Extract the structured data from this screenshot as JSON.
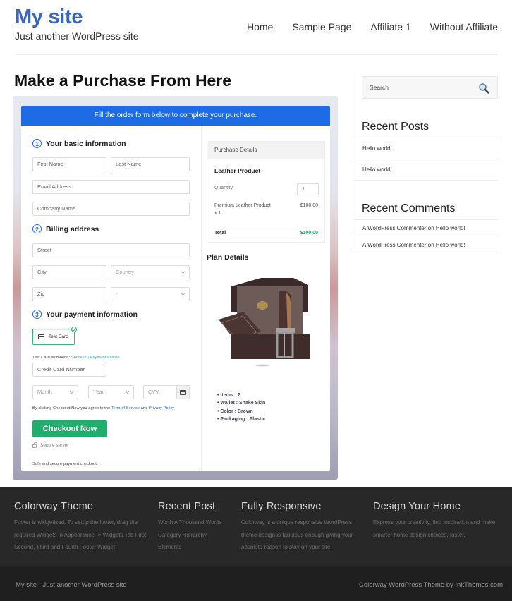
{
  "header": {
    "site_title": "My site",
    "tagline": "Just another WordPress site",
    "nav": [
      "Home",
      "Sample Page",
      "Affiliate 1",
      "Without Affiliate"
    ]
  },
  "main": {
    "page_title": "Make a Purchase From Here",
    "banner": "Fill the order form below to complete your purchase.",
    "steps": [
      "Your basic information",
      "Billing address",
      "Your payment information"
    ],
    "step_numbers": [
      "1",
      "2",
      "3"
    ],
    "fields": {
      "first_name": "First Name",
      "last_name": "Last Name",
      "email": "Email Address",
      "company": "Company Name",
      "street": "Street",
      "city": "City",
      "country": "Country",
      "zip": "Zip",
      "state": "-",
      "card_number": "Credit Card Number",
      "month": "Month",
      "year": "Year",
      "cvv": "CVV"
    },
    "payment_method": "Test Card",
    "test_card_label": "Test Card Numbers :",
    "test_success": "Success",
    "test_sep": "|",
    "test_failure": "Payment Failure",
    "agree_prefix": "By clicking Checkout Now you agree to the",
    "terms": "Term of Service",
    "agree_and": "and",
    "privacy": "Privacy Policy",
    "checkout_button": "Checkout Now",
    "secure_server": "Secure server",
    "safe_text": "Safe and secure payment checkout.",
    "purchase": {
      "heading": "Purchase Details",
      "product": "Leather Product",
      "quantity_label": "Quantity",
      "quantity_value": "1",
      "line_item": "Premium Leather Product",
      "line_qty": "x 1",
      "line_price": "$100.00",
      "total_label": "Total",
      "total_value": "$100.00",
      "total_color": "#21ad6c"
    },
    "plan": {
      "heading": "Plan Details",
      "items": [
        "Items : 2",
        "Wallet : Snake Skin",
        "Color : Brown",
        "Packaging : Plastic"
      ]
    }
  },
  "sidebar": {
    "search_placeholder": "Search",
    "recent_posts_title": "Recent Posts",
    "recent_posts": [
      "Hello world!",
      "Hello world!"
    ],
    "recent_comments_title": "Recent Comments",
    "recent_comments": [
      "A WordPress Commenter on Hello world!",
      "A WordPress Commenter on Hello world!"
    ]
  },
  "footer": {
    "col1_title": "Colorway Theme",
    "col1_text": "Footer is widgetized. To setup the footer, drag the required Widgets in Appearance -> Widgets Tab First, Second, Third and Fourth Footer Widget",
    "col2_title": "Recent Post",
    "col2_links": [
      "Worth A Thousand Words",
      "Category Hierarchy",
      "Elements"
    ],
    "col3_title": "Fully Responsive",
    "col3_text": "Colorway is a unique responsive WordPress theme design is fabulous enough giving your absolute reason to stay on your site.",
    "col4_title": "Design Your Home",
    "col4_text": "Express your creativity, find inspiration and make smarter home design choices, faster.",
    "bottom_left": "My site - Just another WordPress site",
    "bottom_right": "Colorway WordPress Theme by InkThemes.com"
  },
  "colors": {
    "brand": "#3a65b8",
    "banner": "#1e6be6",
    "checkout": "#21ad6c"
  }
}
